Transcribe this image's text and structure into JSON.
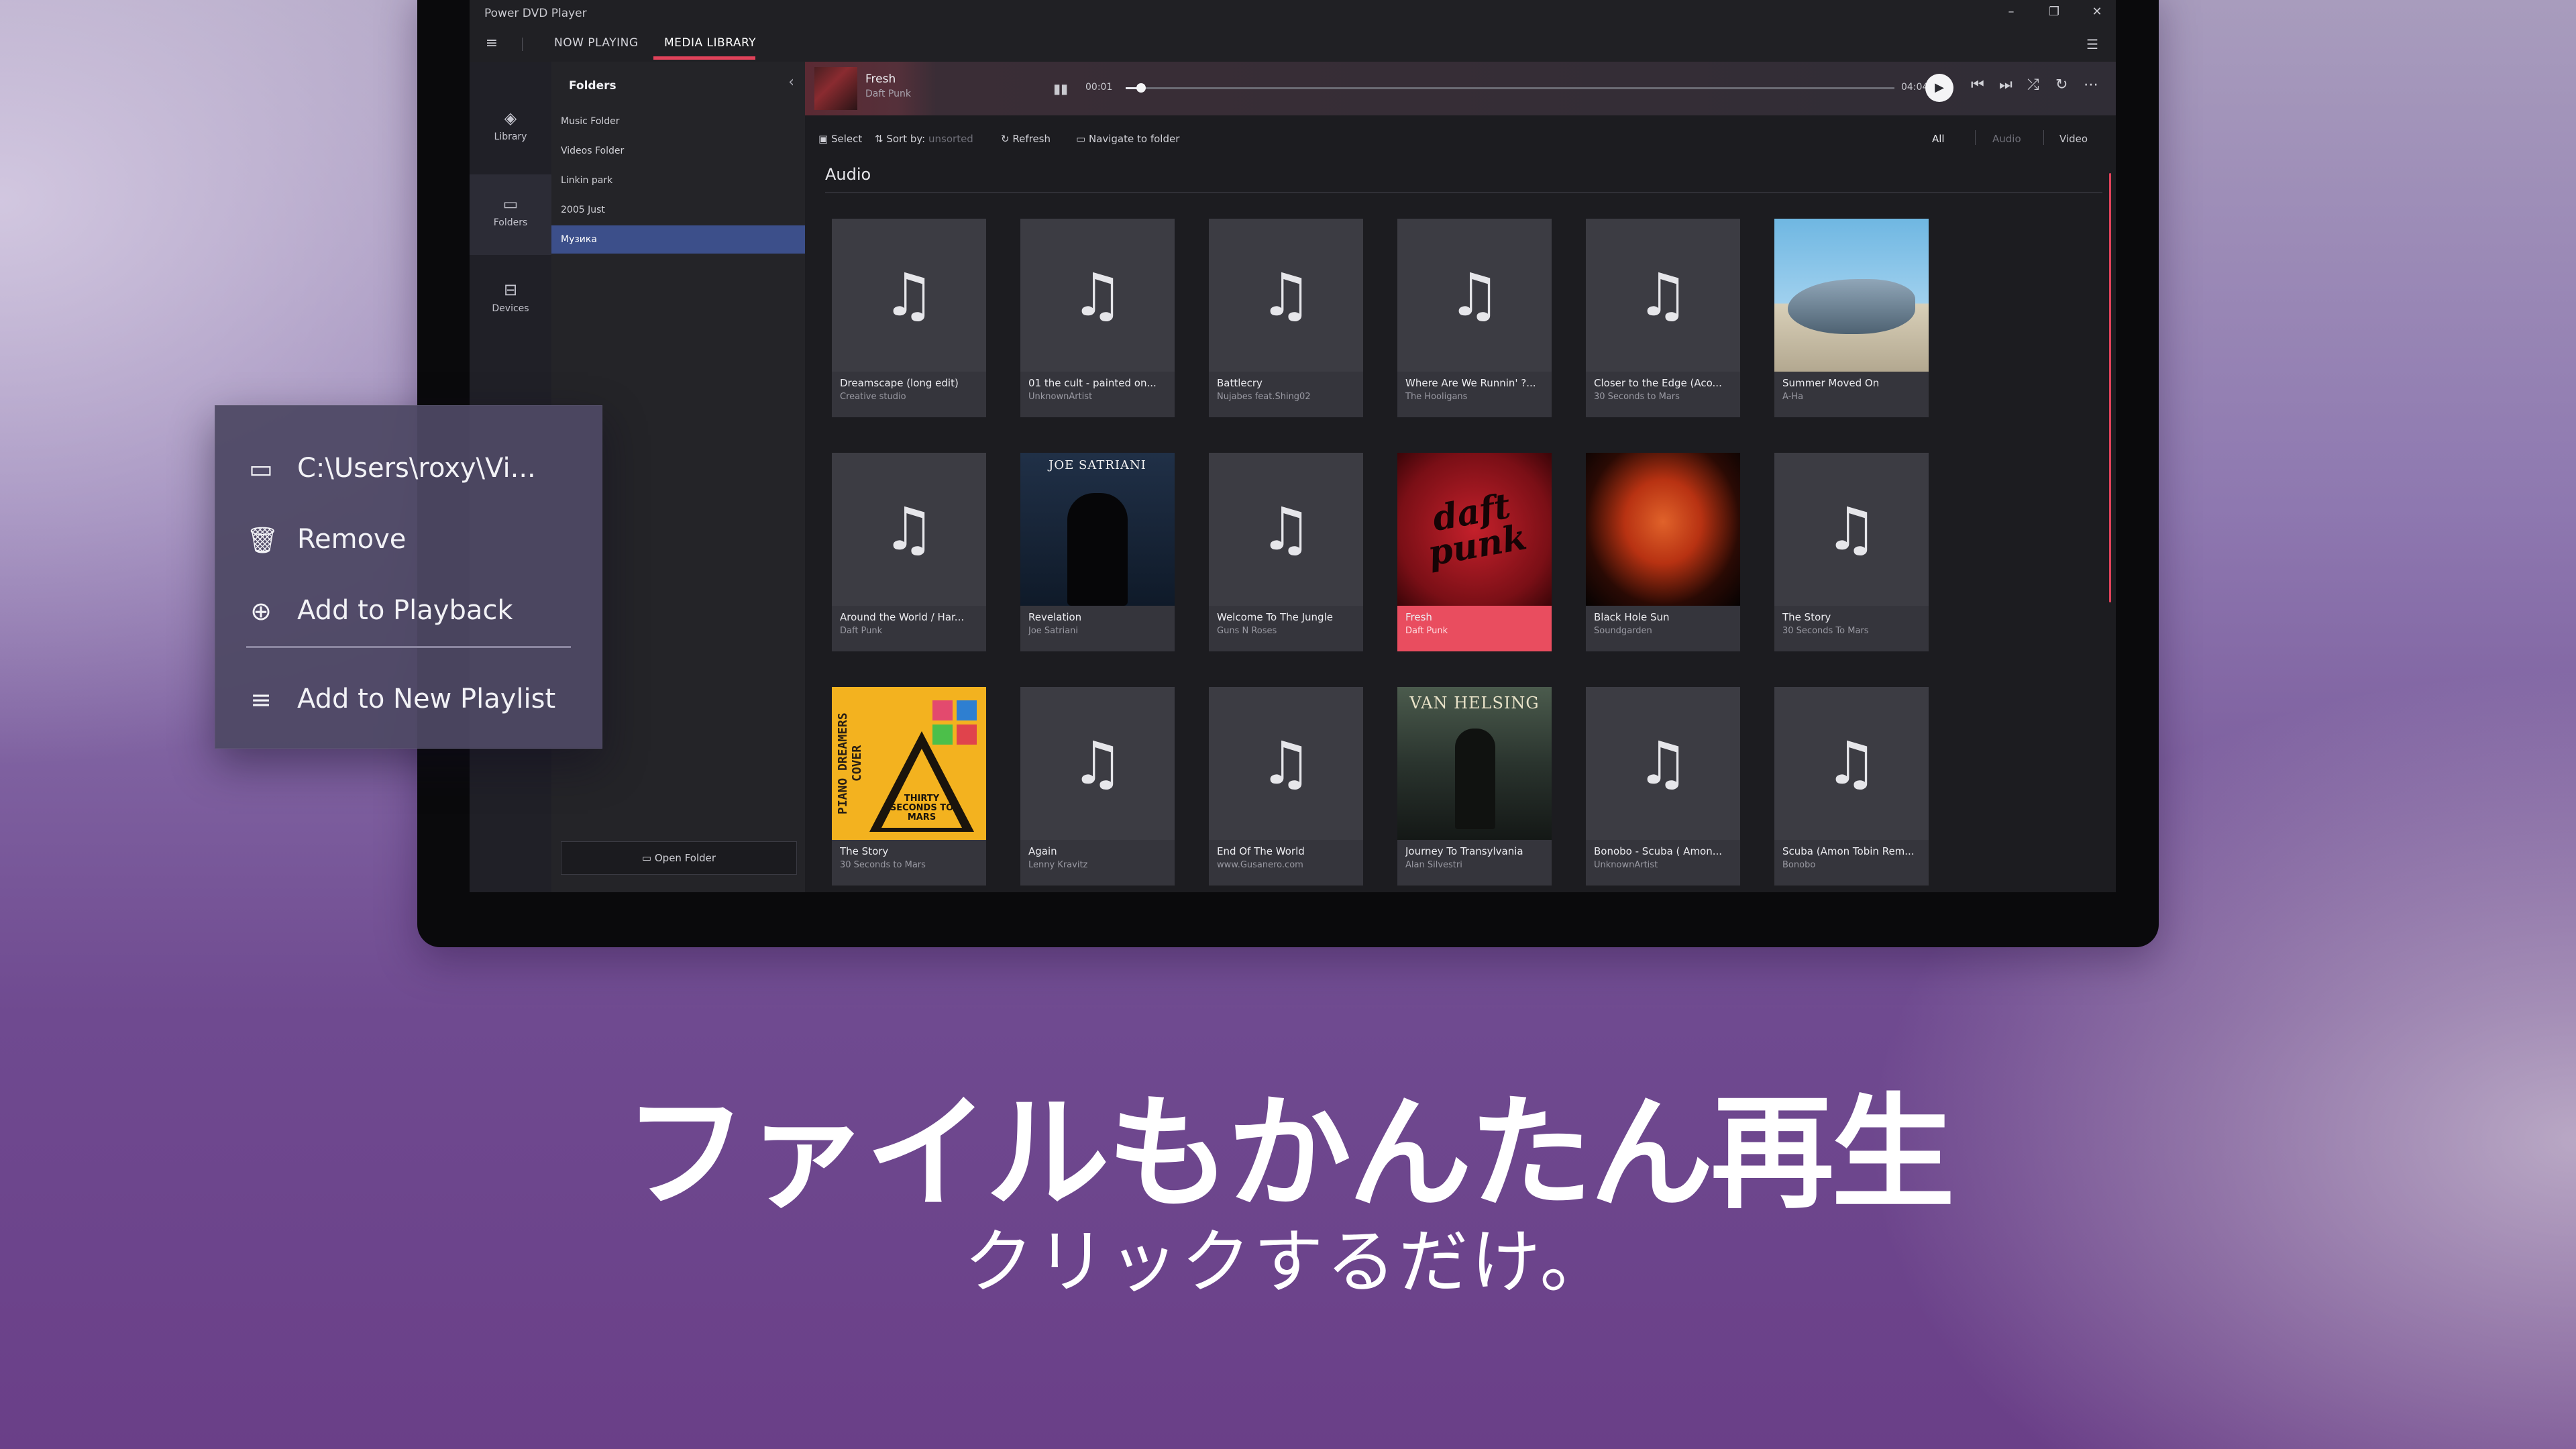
{
  "window": {
    "title": "Power DVD Player"
  },
  "nav": {
    "tabs": [
      "NOW PLAYING",
      "MEDIA LIBRARY"
    ],
    "active_tab": "MEDIA LIBRARY"
  },
  "rail": [
    {
      "label": "Library",
      "icon": "library-icon"
    },
    {
      "label": "Folders",
      "icon": "folder-icon"
    },
    {
      "label": "Devices",
      "icon": "devices-icon"
    }
  ],
  "folders": {
    "title": "Folders",
    "items": [
      "Music Folder",
      "Videos Folder",
      "Linkin park",
      "2005 Just",
      "Музика"
    ],
    "selected": "Музика",
    "open_folder_label": "Open Folder"
  },
  "player": {
    "title": "Fresh",
    "artist": "Daft Punk",
    "current_time": "00:01",
    "total_time": "04:04",
    "progress": 0.02
  },
  "toolbar": {
    "select": "Select",
    "sort_label": "Sort by:",
    "sort_value": "unsorted",
    "refresh": "Refresh",
    "navigate": "Navigate to folder",
    "filters": [
      "All",
      "Audio",
      "Video"
    ],
    "active_filter": "All"
  },
  "section": {
    "title": "Audio"
  },
  "tracks": [
    {
      "title": "Dreamscape (long edit)",
      "artist": "Creative studio",
      "art": "note"
    },
    {
      "title": "01 the cult - painted on...",
      "artist": "UnknownArtist",
      "art": "note"
    },
    {
      "title": "Battlecry",
      "artist": "Nujabes feat.Shing02",
      "art": "note"
    },
    {
      "title": "Where Are We Runnin' ?...",
      "artist": "The Hooligans",
      "art": "note"
    },
    {
      "title": "Closer to the Edge (Aco...",
      "artist": "30 Seconds to Mars",
      "art": "note"
    },
    {
      "title": "Summer Moved On",
      "artist": "A-Ha",
      "art": "sky"
    },
    {
      "title": "Around the World / Har...",
      "artist": "Daft Punk",
      "art": "note"
    },
    {
      "title": "Revelation",
      "artist": "Joe Satriani",
      "art": "joe",
      "art_text": "JOE SATRIANI"
    },
    {
      "title": "Welcome To The Jungle",
      "artist": "Guns N Roses",
      "art": "note"
    },
    {
      "title": "Fresh",
      "artist": "Daft Punk",
      "art": "daft",
      "art_text": "daft punk",
      "highlighted": true
    },
    {
      "title": "Black Hole Sun",
      "artist": "Soundgarden",
      "art": "bhs"
    },
    {
      "title": "The Story",
      "artist": "30 Seconds To Mars",
      "art": "note"
    },
    {
      "title": "The Story",
      "artist": "30 Seconds to Mars",
      "art": "piano",
      "art_text": "PIANO DREAMERS COVER",
      "art_text2": "THIRTY SECONDS TO MARS"
    },
    {
      "title": "Again",
      "artist": "Lenny Kravitz",
      "art": "note"
    },
    {
      "title": "End Of The World",
      "artist": "www.Gusanero.com",
      "art": "note"
    },
    {
      "title": "Journey To Transylvania",
      "artist": "Alan Silvestri",
      "art": "van",
      "art_text": "VAN HELSING"
    },
    {
      "title": "Bonobo - Scuba ( Amon...",
      "artist": "UnknownArtist",
      "art": "note"
    },
    {
      "title": "Scuba (Amon Tobin Rem...",
      "artist": "Bonobo",
      "art": "note"
    }
  ],
  "context_menu": [
    {
      "label": "C:\\Users\\roxy\\Vi...",
      "icon": "folder-open-icon"
    },
    {
      "label": "Remove",
      "icon": "trash-icon"
    },
    {
      "label": "Add to Playback",
      "icon": "add-circle-icon"
    },
    {
      "label": "Add to New Playlist",
      "icon": "playlist-add-icon"
    }
  ],
  "caption": {
    "headline": "ファイルもかんたん再生",
    "subline": "クリックするだけ。"
  },
  "colors": {
    "accent": "#e0425a",
    "highlight_card": "#e94d5f",
    "selected_folder": "#3c4f8a"
  }
}
